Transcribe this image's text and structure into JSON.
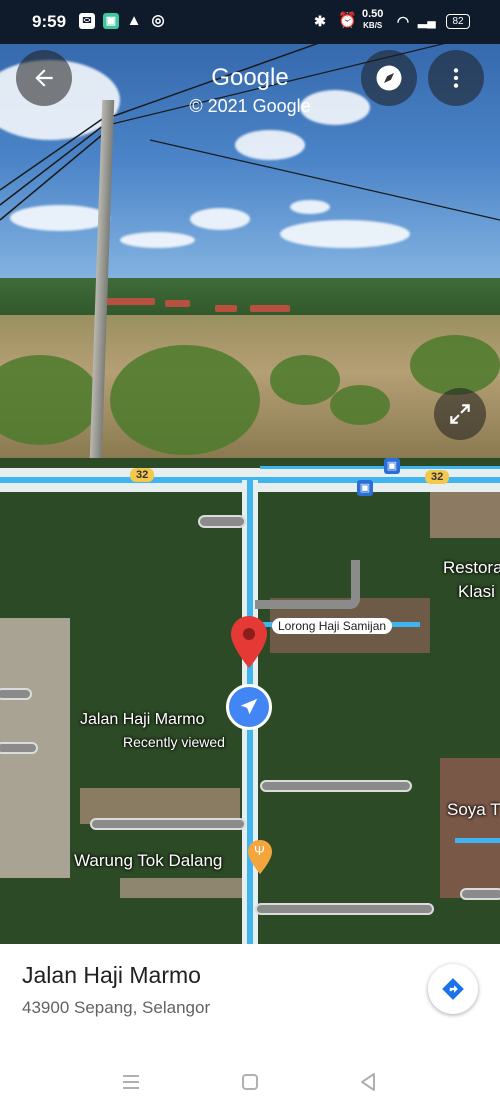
{
  "status_bar": {
    "time": "9:59",
    "net_speed": "0.50",
    "net_unit": "KB/S",
    "battery": "82"
  },
  "street_view": {
    "title": "Google",
    "copyright": "© 2021 Google"
  },
  "map": {
    "route_shield_1": "32",
    "route_shield_2": "32",
    "street_pill": "Lorong Haji Samijan",
    "selected_label": "Jalan Haji Marmo",
    "selected_sublabel": "Recently viewed",
    "poi_warung": "Warung Tok Dalang",
    "poi_restoran_1": "Restora",
    "poi_restoran_2": "Klasi",
    "poi_soya": "Soya T"
  },
  "place": {
    "name": "Jalan Haji Marmo",
    "address": "43900 Sepang, Selangor"
  },
  "icons": [
    "back-arrow-icon",
    "compass-icon",
    "more-vert-icon",
    "expand-icon",
    "location-pin-icon",
    "navigation-arrow-icon",
    "fork-knife-icon",
    "directions-icon",
    "menu-icon",
    "home-icon",
    "back-icon",
    "bus-icon"
  ],
  "colors": {
    "route_blue": "#3fb4ef",
    "pin_red": "#e53935",
    "nav_blue": "#4285f4",
    "shield_yellow": "#f2c94c",
    "poi_orange": "#f4a53b"
  }
}
